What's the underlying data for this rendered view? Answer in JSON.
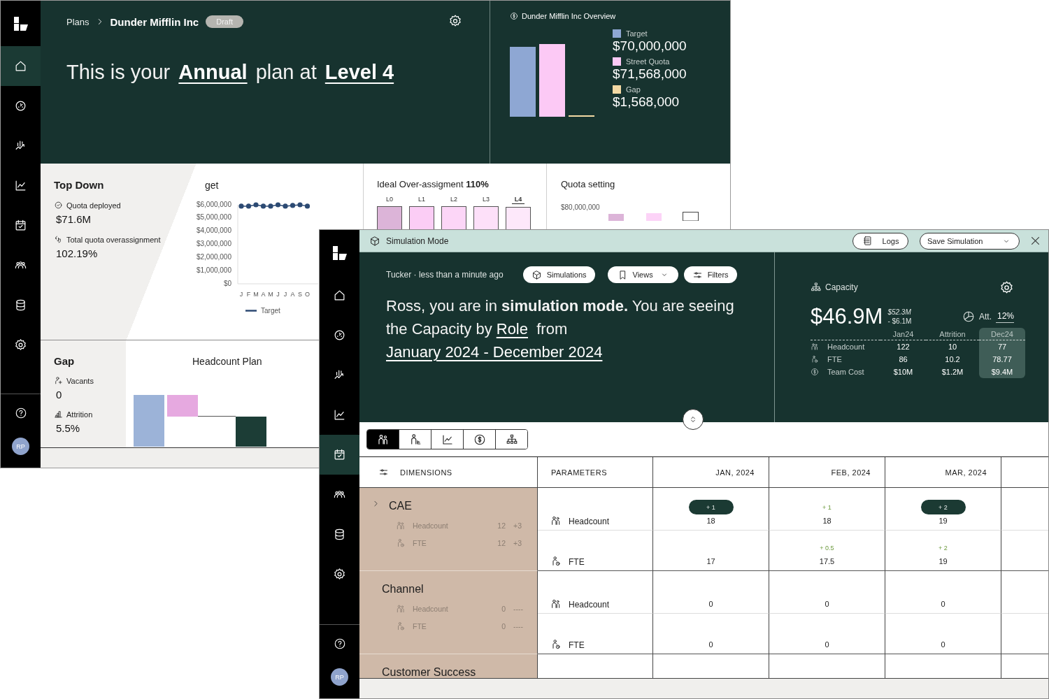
{
  "background_window": {
    "nav": [
      {
        "selected": true
      },
      {
        "selected": false
      },
      {
        "selected": false
      },
      {
        "selected": false
      },
      {
        "selected": false
      },
      {
        "selected": false
      },
      {
        "selected": false
      },
      {
        "selected": false
      }
    ],
    "avatar": "RP",
    "breadcrumb": {
      "parent": "Plans",
      "current": "Dunder Mifflin Inc",
      "badge": "Draft"
    },
    "headline": {
      "prefix": "This is your",
      "period": "Annual",
      "middle": "plan at",
      "level": "Level 4"
    },
    "overview": {
      "title": "Dunder Mifflin Inc Overview",
      "legend": [
        {
          "label": "Target",
          "value": "$70,000,000",
          "color": "#8ea7d3"
        },
        {
          "label": "Street Quota",
          "value": "$71,568,000",
          "color": "#fcc9f5"
        },
        {
          "label": "Gap",
          "value": "$1,568,000",
          "color": "#f3d9a4"
        }
      ]
    },
    "top_down": {
      "title": "Top Down",
      "metrics": [
        {
          "kind": "deployed",
          "label": "Quota deployed",
          "value": "$71.6M"
        },
        {
          "kind": "overassignment",
          "label": "Total quota overassignment",
          "value": "102.19%"
        }
      ],
      "chart_data": {
        "type": "line",
        "title": "get",
        "categories": [
          "J",
          "F",
          "M",
          "A",
          "M",
          "J",
          "J",
          "A",
          "S",
          "O"
        ],
        "series": [
          {
            "name": "Target",
            "color": "#2c4a73",
            "marker": "circle",
            "values": [
              5900000,
              5900000,
              6000000,
              5900000,
              5900000,
              6000000,
              5900000,
              5950000,
              6000000,
              5900000
            ]
          }
        ],
        "ylim": [
          0,
          6000000
        ],
        "yticks": [
          {
            "value": 0,
            "label": "$0"
          },
          {
            "value": 1000000,
            "label": "$1,000,000"
          },
          {
            "value": 2000000,
            "label": "$2,000,000"
          },
          {
            "value": 3000000,
            "label": "$3,000,000"
          },
          {
            "value": 4000000,
            "label": "$4,000,000"
          },
          {
            "value": 5000000,
            "label": "$5,000,000"
          },
          {
            "value": 6000000,
            "label": "$6,000,000"
          }
        ]
      }
    },
    "over_assignment": {
      "title": "Ideal Over-assigment **110%**",
      "levels": [
        {
          "label": "L0",
          "selected": false,
          "color": "#dcb4d8"
        },
        {
          "label": "L1",
          "selected": false,
          "color": "#fbcdf5"
        },
        {
          "label": "L2",
          "selected": false,
          "color": "#fcd6f7"
        },
        {
          "label": "L3",
          "selected": false,
          "color": "#fde0f9"
        },
        {
          "label": "L4",
          "selected": true,
          "color": "#fde8fa"
        }
      ]
    },
    "quota_setting": {
      "title": "Quota setting",
      "tick": "$80,000,000"
    },
    "gap": {
      "title": "Gap",
      "metrics": [
        {
          "kind": "vacants",
          "label": "Vacants",
          "value": "0"
        },
        {
          "kind": "attrition",
          "label": "Attrition",
          "value": "5.5%"
        }
      ]
    },
    "headcount_plan": {
      "title": "Headcount Plan"
    }
  },
  "simulation_window": {
    "nav": [
      {
        "selected": false
      },
      {
        "selected": false
      },
      {
        "selected": false
      },
      {
        "selected": false
      },
      {
        "selected": true
      },
      {
        "selected": false
      },
      {
        "selected": false
      },
      {
        "selected": false
      }
    ],
    "avatar": "RP",
    "title": "Simulation Mode",
    "logs_button": "Logs",
    "save_button": "Save Simulation",
    "meta": "Tucker · less than a minute ago",
    "toolbar": [
      {
        "kind": "simulations",
        "label": "Simulations"
      },
      {
        "kind": "views",
        "label": "Views"
      },
      {
        "kind": "filters",
        "label": "Filters"
      }
    ],
    "message": {
      "text": "Ross, you are in **simulation mode.** You are seeing the Capacity by",
      "role": "Role",
      "after": "from",
      "range": "January 2024 - December 2024"
    },
    "capacity": {
      "title": "Capacity",
      "total": "$46.9M",
      "before": "$52.3M",
      "change": "- $6.1M",
      "att_label": "Att.",
      "att_value": "12%",
      "columns": [
        {
          "label": "Jan24",
          "highlighted": false
        },
        {
          "label": "Attrition",
          "highlighted": false
        },
        {
          "label": "Dec24",
          "highlighted": true
        }
      ],
      "rows": [
        {
          "kind": "group",
          "label": "Headcount",
          "cells": [
            "122",
            "10",
            "77"
          ]
        },
        {
          "kind": "person",
          "label": "FTE",
          "cells": [
            "86",
            "10.2",
            "78.77"
          ]
        },
        {
          "kind": "money",
          "label": "Team Cost",
          "cells": [
            "$10M",
            "$1.2M",
            "$9.4M"
          ]
        }
      ]
    },
    "view_tabs": [
      {
        "kind": "group",
        "selected": true
      },
      {
        "kind": "fte",
        "selected": false
      },
      {
        "kind": "line",
        "selected": false
      },
      {
        "kind": "money",
        "selected": false
      },
      {
        "kind": "org",
        "selected": false
      }
    ],
    "table": {
      "columns": [
        "DIMENSIONS",
        "PARAMETERS",
        "JAN, 2024",
        "FEB, 2024",
        "MAR, 2024"
      ],
      "groups": [
        {
          "name": "CAE",
          "expandable": true,
          "summary": [
            {
              "kind": "group",
              "label": "Headcount",
              "count": "12",
              "delta": "+3"
            },
            {
              "kind": "person",
              "label": "FTE",
              "count": "12",
              "delta": "+3"
            }
          ],
          "params": [
            {
              "kind": "group",
              "label": "Headcount",
              "cells": [
                {
                  "kind": "pill",
                  "delta": "+ 1",
                  "value": "18"
                },
                {
                  "kind": "plain",
                  "delta": "+ 1",
                  "value": "18"
                },
                {
                  "kind": "pill",
                  "delta": "+ 2",
                  "value": "19"
                }
              ]
            },
            {
              "kind": "person",
              "label": "FTE",
              "cells": [
                {
                  "value": "17"
                },
                {
                  "kind": "plain",
                  "delta": "+ 0.5",
                  "value": "17.5"
                },
                {
                  "kind": "plain",
                  "delta": "+ 2",
                  "value": "19"
                }
              ]
            }
          ]
        },
        {
          "name": "Channel",
          "expandable": false,
          "summary": [
            {
              "kind": "group",
              "label": "Headcount",
              "count": "0",
              "delta": "----"
            },
            {
              "kind": "person",
              "label": "FTE",
              "count": "0",
              "delta": "----"
            }
          ],
          "params": [
            {
              "kind": "group",
              "label": "Headcount",
              "cells": [
                {
                  "value": "0"
                },
                {
                  "value": "0"
                },
                {
                  "value": "0"
                }
              ]
            },
            {
              "kind": "person",
              "label": "FTE",
              "cells": [
                {
                  "value": "0"
                },
                {
                  "value": "0"
                },
                {
                  "value": "0"
                }
              ]
            }
          ]
        },
        {
          "name": "Customer Success",
          "expandable": false
        }
      ]
    }
  }
}
